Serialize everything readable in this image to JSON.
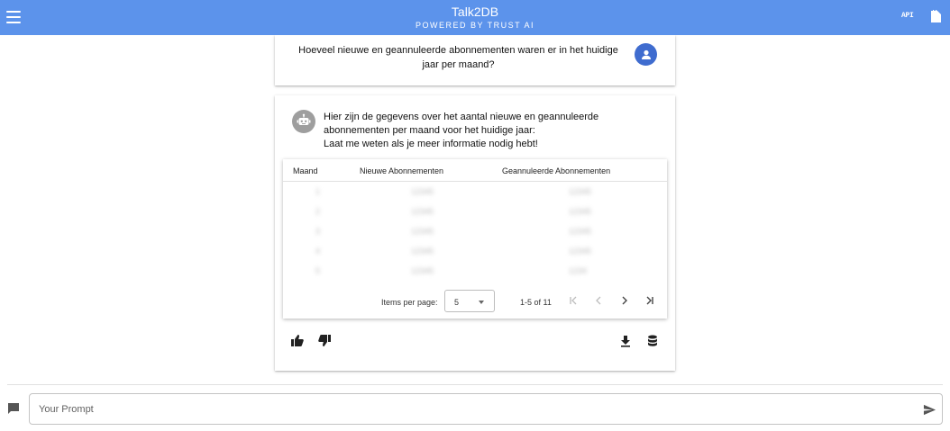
{
  "header": {
    "title": "Talk2DB",
    "subtitle": "POWERED BY TRUST AI",
    "api_label": "API",
    "bg_color": "#5c93eb"
  },
  "question": {
    "text": "Hoeveel nieuwe en geannuleerde abonnementen waren er in het huidige jaar per maand?",
    "avatar_icon": "account-icon"
  },
  "answer": {
    "line1": "Hier zijn de gegevens over het aantal nieuwe en geannuleerde abonnementen per maand voor het huidige jaar:",
    "line2": "Laat me weten als je meer informatie nodig hebt!",
    "avatar_icon": "robot-icon"
  },
  "table": {
    "columns": [
      "Maand",
      "Nieuwe Abonnementen",
      "Geannuleerde Abonnementen"
    ],
    "rows": [
      [
        "1",
        "12345",
        "12345"
      ],
      [
        "2",
        "12345",
        "12345"
      ],
      [
        "3",
        "12345",
        "12345"
      ],
      [
        "4",
        "12345",
        "12345"
      ],
      [
        "5",
        "12345",
        "1234"
      ]
    ],
    "paginator": {
      "items_per_page_label": "Items per page:",
      "items_per_page": "5",
      "range": "1-5 of 11"
    }
  },
  "prompt": {
    "placeholder": "Your Prompt"
  }
}
